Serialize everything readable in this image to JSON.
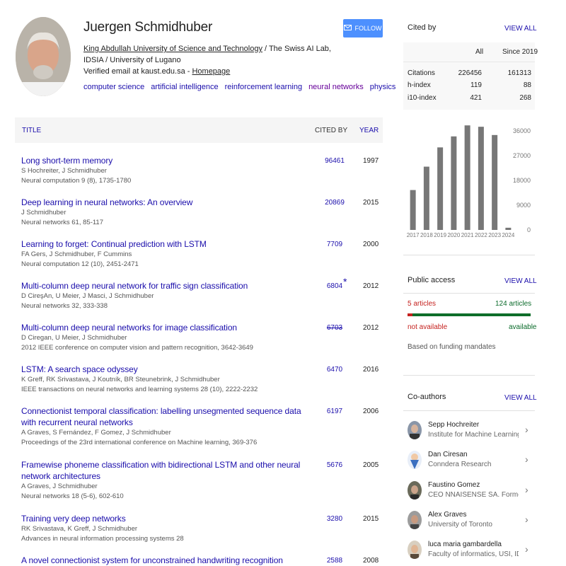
{
  "profile": {
    "name": "Juergen Schmidhuber",
    "follow_label": "FOLLOW",
    "affiliation_link": "King Abdullah University of Science and Technology",
    "affiliation_rest": " / The Swiss AI Lab, IDSIA / University of Lugano",
    "email_text": "Verified email at kaust.edu.sa - ",
    "homepage_label": "Homepage",
    "interests": [
      "computer science",
      "artificial intelligence",
      "reinforcement learning",
      "neural networks",
      "physics"
    ]
  },
  "table": {
    "header_title": "TITLE",
    "header_cited": "CITED BY",
    "header_year": "YEAR",
    "rows": [
      {
        "title": "Long short-term memory",
        "authors": "S Hochreiter, J Schmidhuber",
        "venue": "Neural computation 9 (8), 1735-1780",
        "cites": "96461",
        "year": "1997"
      },
      {
        "title": "Deep learning in neural networks: An overview",
        "authors": "J Schmidhuber",
        "venue": "Neural networks 61, 85-117",
        "cites": "20869",
        "year": "2015"
      },
      {
        "title": "Learning to forget: Continual prediction with LSTM",
        "authors": "FA Gers, J Schmidhuber, F Cummins",
        "venue": "Neural computation 12 (10), 2451-2471",
        "cites": "7709",
        "year": "2000"
      },
      {
        "title": "Multi-column deep neural network for traffic sign classification",
        "authors": "D CireşAn, U Meier, J Masci, J Schmidhuber",
        "venue": "Neural networks 32, 333-338",
        "cites": "6804",
        "star": "*",
        "year": "2012"
      },
      {
        "title": "Multi-column deep neural networks for image classification",
        "authors": "D Ciregan, U Meier, J Schmidhuber",
        "venue": "2012 IEEE conference on computer vision and pattern recognition, 3642-3649",
        "cites": "6703",
        "strike": true,
        "year": "2012"
      },
      {
        "title": "LSTM: A search space odyssey",
        "authors": "K Greff, RK Srivastava, J Koutník, BR Steunebrink, J Schmidhuber",
        "venue": "IEEE transactions on neural networks and learning systems 28 (10), 2222-2232",
        "cites": "6470",
        "year": "2016"
      },
      {
        "title": "Connectionist temporal classification: labelling unsegmented sequence data with recurrent neural networks",
        "authors": "A Graves, S Fernández, F Gomez, J Schmidhuber",
        "venue": "Proceedings of the 23rd international conference on Machine learning, 369-376",
        "cites": "6197",
        "year": "2006"
      },
      {
        "title": "Framewise phoneme classification with bidirectional LSTM and other neural network architectures",
        "authors": "A Graves, J Schmidhuber",
        "venue": "Neural networks 18 (5-6), 602-610",
        "cites": "5676",
        "year": "2005"
      },
      {
        "title": "Training very deep networks",
        "authors": "RK Srivastava, K Greff, J Schmidhuber",
        "venue": "Advances in neural information processing systems 28",
        "cites": "3280",
        "year": "2015"
      },
      {
        "title": "A novel connectionist system for unconstrained handwriting recognition",
        "authors": "",
        "venue": "",
        "cites": "2588",
        "year": "2008"
      }
    ]
  },
  "cited_by": {
    "heading": "Cited by",
    "view_all": "VIEW ALL",
    "col_all": "All",
    "col_since": "Since 2019",
    "rows": [
      {
        "label": "Citations",
        "all": "226456",
        "since": "161313"
      },
      {
        "label": "h-index",
        "all": "119",
        "since": "88"
      },
      {
        "label": "i10-index",
        "all": "421",
        "since": "268"
      }
    ]
  },
  "chart_data": {
    "type": "bar",
    "categories": [
      "2017",
      "2018",
      "2019",
      "2020",
      "2021",
      "2022",
      "2023",
      "2024"
    ],
    "values": [
      14500,
      23000,
      30000,
      34000,
      38000,
      37500,
      34500,
      800
    ],
    "ylim": [
      0,
      36000
    ],
    "yticks": [
      0,
      9000,
      18000,
      27000,
      36000
    ],
    "bar_color": "#777777"
  },
  "public_access": {
    "heading": "Public access",
    "view_all": "VIEW ALL",
    "unavailable_count": "5 articles",
    "available_count": "124 articles",
    "unavailable_fraction": 0.039,
    "not_available_label": "not available",
    "available_label": "available",
    "mandates_note": "Based on funding mandates"
  },
  "coauthors": {
    "heading": "Co-authors",
    "view_all": "VIEW ALL",
    "items": [
      {
        "name": "Sepp Hochreiter",
        "affiliation": "Institute for Machine Learning, J..."
      },
      {
        "name": "Dan Ciresan",
        "affiliation": "Conndera Research"
      },
      {
        "name": "Faustino Gomez",
        "affiliation": "CEO NNAISENSE SA. Former S..."
      },
      {
        "name": "Alex Graves",
        "affiliation": "University of Toronto"
      },
      {
        "name": "luca maria gambardella",
        "affiliation": "Faculty of informatics, USI, IDSI..."
      }
    ]
  },
  "colors": {
    "link": "#1a0dab",
    "follow_button": "#4d90fe",
    "not_available": "#c5221f",
    "available": "#0b6b2b"
  }
}
